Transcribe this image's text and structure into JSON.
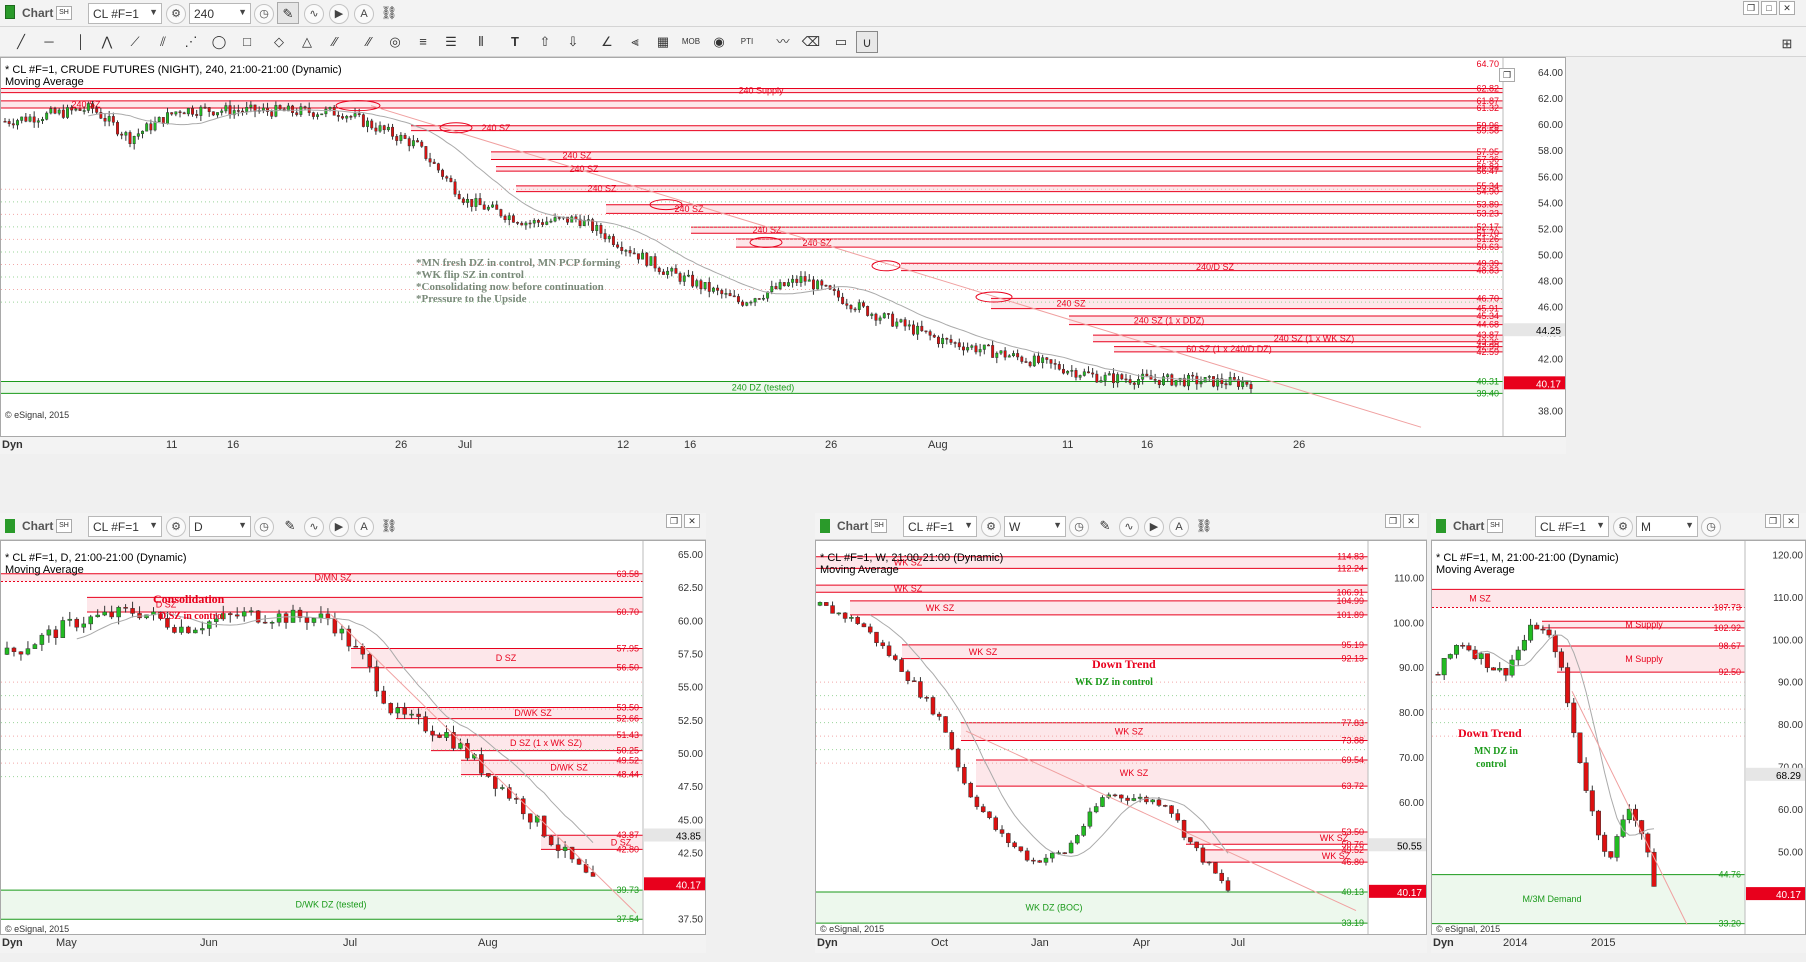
{
  "app": {
    "chart_label": "Chart",
    "copyright": "© eSignal, 2015",
    "dyn_label": "Dyn"
  },
  "top": {
    "symbol": "CL #F=1",
    "interval": "240",
    "header": "* CL #F=1, CRUDE FUTURES (NIGHT), 240, 21:00-21:00 (Dynamic)",
    "study": "Moving Average",
    "x_labels": [
      "11",
      "16",
      "26",
      "Jul",
      "12",
      "16",
      "26",
      "Aug",
      "11",
      "16",
      "26"
    ],
    "y_labels": [
      "64.00",
      "62.00",
      "60.00",
      "58.00",
      "56.00",
      "54.00",
      "52.00",
      "50.00",
      "48.00",
      "46.00",
      "44.00",
      "42.00",
      "40.00",
      "38.00"
    ],
    "cursor_price": "44.25",
    "last_price": "40.17",
    "price_tags": [
      "64.70",
      "62.82",
      "61.87",
      "61.32",
      "59.96",
      "59.58",
      "57.95",
      "57.36",
      "56.82",
      "56.47",
      "55.34",
      "54.90",
      "53.89",
      "53.23",
      "52.17",
      "51.70",
      "51.26",
      "50.63",
      "49.39",
      "48.83",
      "46.70",
      "45.91",
      "45.34",
      "44.68",
      "43.87",
      "43.36",
      "42.99",
      "42.59",
      "40.31",
      "39.40"
    ],
    "zone_labels": [
      "240 Supply",
      "240 SZ",
      "240 SZ",
      "240 SZ",
      "240 SZ",
      "240 SZ",
      "240 SZ",
      "240 SZ",
      "240 SZ",
      "240/D SZ",
      "240 SZ",
      "240 SZ (1 x DDZ)",
      "240 SZ (1 x WK SZ)",
      "60 SZ (1 x 240/D DZ)",
      "240 DZ (tested)"
    ],
    "notes": [
      "*MN fresh DZ in control, MN PCP forming",
      "*WK flip SZ in control",
      "*Consolidating now before continuation",
      "*Pressure to the Upside"
    ]
  },
  "daily": {
    "symbol": "CL #F=1",
    "interval": "D",
    "header": "* CL #F=1, D, 21:00-21:00 (Dynamic)",
    "study": "Moving Average",
    "x_labels": [
      "May",
      "Jun",
      "Jul",
      "Aug"
    ],
    "y_labels": [
      "65.00",
      "62.50",
      "60.00",
      "57.50",
      "55.00",
      "52.50",
      "50.00",
      "47.50",
      "45.00",
      "42.50",
      "40.00",
      "37.50"
    ],
    "cursor_price": "43.85",
    "last_price": "40.17",
    "price_tags": [
      "63.58",
      "60.70",
      "57.95",
      "56.50",
      "53.50",
      "52.66",
      "51.43",
      "50.25",
      "49.52",
      "48.44",
      "43.87",
      "42.80",
      "39.73",
      "37.54"
    ],
    "zone_labels": [
      "D/MN SZ",
      "D SZ",
      "D SZ",
      "D/WK SZ",
      "D SZ (1 x WK SZ)",
      "D/WK SZ",
      "D SZ",
      "D/WK DZ (tested)"
    ],
    "title_note": "Consolidation",
    "sub_note": "D SZ in control"
  },
  "weekly": {
    "symbol": "CL #F=1",
    "interval": "W",
    "header": "* CL #F=1, W, 21:00-21:00 (Dynamic)",
    "study": "Moving Average",
    "x_labels": [
      "Oct",
      "Jan",
      "Apr",
      "Jul"
    ],
    "y_labels": [
      "110.00",
      "100.00",
      "90.00",
      "80.00",
      "70.00",
      "60.00",
      "50.00"
    ],
    "cursor_price": "50.55",
    "last_price": "40.17",
    "price_tags": [
      "114.83",
      "112.24",
      "106.91",
      "104.99",
      "101.89",
      "95.19",
      "92.13",
      "77.83",
      "73.88",
      "69.54",
      "63.72",
      "53.50",
      "50.76",
      "49.52",
      "46.80",
      "40.13",
      "33.19"
    ],
    "zone_labels": [
      "WK SZ",
      "WK SZ",
      "WK SZ",
      "WK SZ",
      "WK SZ",
      "WK SZ",
      "WK SZ",
      "WK SZ",
      "WK DZ (BOC)"
    ],
    "title_note": "Down Trend",
    "sub_note": "WK DZ in control"
  },
  "monthly": {
    "symbol": "CL #F=1",
    "interval": "M",
    "header": "* CL #F=1, M, 21:00-21:00 (Dynamic)",
    "study": "Moving Average",
    "x_labels": [
      "2014",
      "2015"
    ],
    "y_labels": [
      "120.00",
      "110.00",
      "100.00",
      "90.00",
      "80.00",
      "70.00",
      "60.00",
      "50.00",
      "40.00"
    ],
    "cursor_price": "68.29",
    "last_price": "40.17",
    "price_tags": [
      "107.73",
      "102.92",
      "98.67",
      "92.50",
      "44.76",
      "33.20"
    ],
    "zone_labels": [
      "M SZ",
      "M Supply",
      "M Supply",
      "M/3M Demand"
    ],
    "title_note": "Down Trend",
    "sub_note_1": "MN DZ in",
    "sub_note_2": "control"
  },
  "colors": {
    "supply": "#e8001c",
    "supply_fill": "#fde3e6",
    "demand": "#1a9a1a",
    "demand_fill": "#eaf7ea",
    "candle_up": "#22bb22",
    "candle_down": "#dd1111",
    "tag": "#e8001c"
  }
}
